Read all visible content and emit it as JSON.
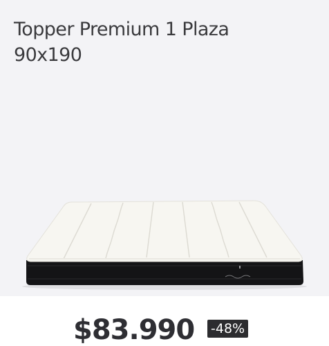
{
  "product": {
    "title_line1": "Topper Premium 1 Plaza",
    "title_line2": "90x190",
    "price": "$83.990",
    "discount": "-48%"
  },
  "colors": {
    "image_background": "#f3f3f6",
    "mattress_top": "#f7f6f1",
    "mattress_border": "#151517",
    "text": "#3a3a3d",
    "badge_background": "#2c2c2f"
  }
}
